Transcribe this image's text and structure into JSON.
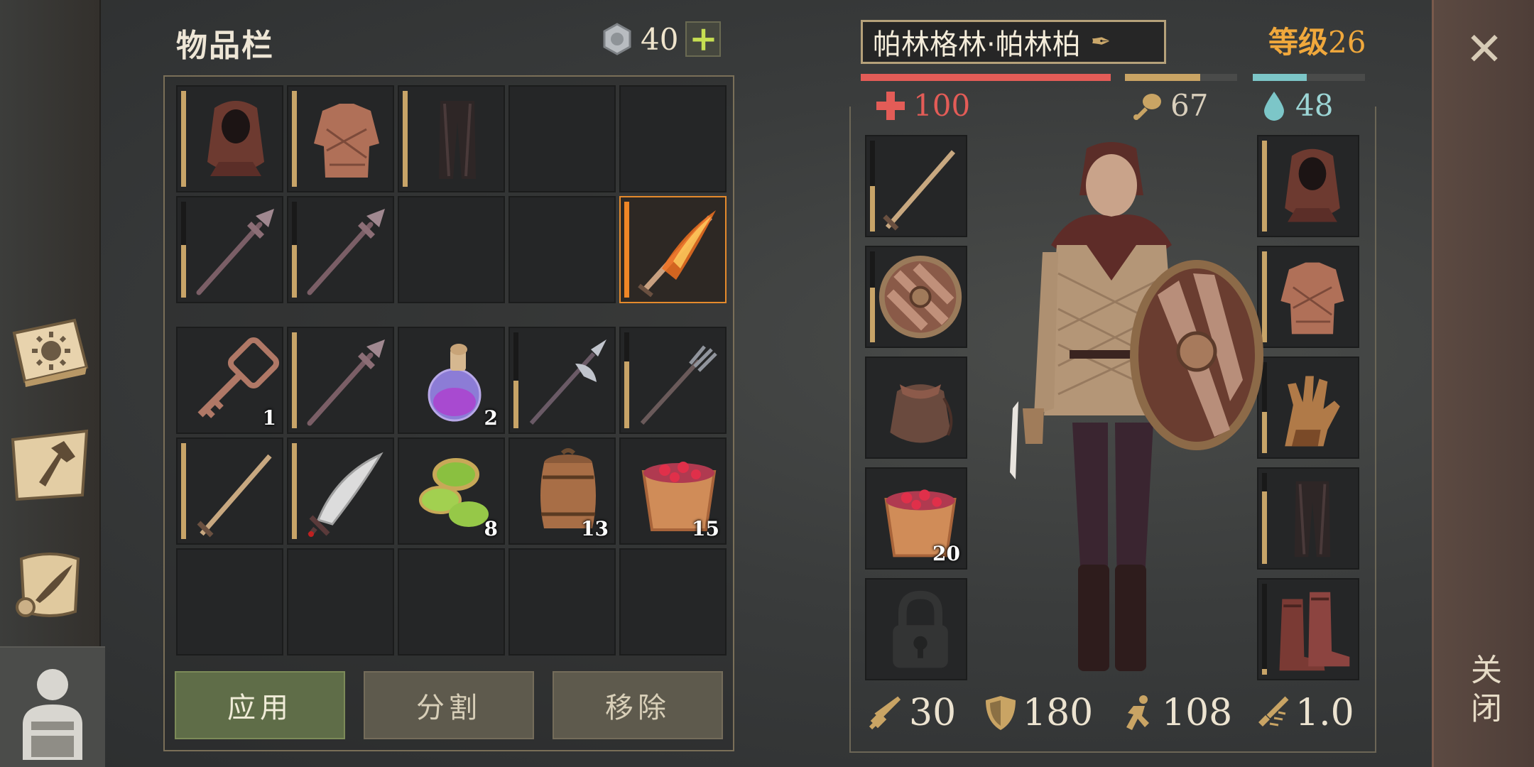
{
  "inventory": {
    "title": "物品栏",
    "coins": "40",
    "add_label": "+",
    "grid_top": [
      {
        "item": "hood",
        "durability": 1
      },
      {
        "item": "gambeson",
        "durability": 1
      },
      {
        "item": "trousers",
        "durability": 1
      },
      {
        "item": "empty"
      },
      {
        "item": "empty"
      },
      {
        "item": "spear",
        "durability": 0.55
      },
      {
        "item": "spear",
        "durability": 0.55
      },
      {
        "item": "empty"
      },
      {
        "item": "empty"
      },
      {
        "item": "flaming-sword",
        "durability": 1,
        "highlight": true
      }
    ],
    "grid_bottom": [
      {
        "item": "key",
        "qty": "1"
      },
      {
        "item": "spear",
        "durability": 1
      },
      {
        "item": "potion",
        "qty": "2"
      },
      {
        "item": "halberd",
        "durability": 0.5
      },
      {
        "item": "pitchfork",
        "durability": 0.7
      },
      {
        "item": "sword",
        "durability": 1
      },
      {
        "item": "scimitar",
        "durability": 1
      },
      {
        "item": "seeds",
        "qty": "8"
      },
      {
        "item": "barrel",
        "qty": "13"
      },
      {
        "item": "berry-bucket",
        "qty": "15"
      }
    ],
    "buttons": {
      "apply": "应用",
      "split": "分割",
      "remove": "移除"
    }
  },
  "character": {
    "name": "帕林格林·帕林柏",
    "level_label": "等级",
    "level": "26",
    "health": "100",
    "food": "67",
    "water": "48",
    "health_fraction": 1.0,
    "food_fraction": 0.67,
    "water_fraction": 0.48,
    "colors": {
      "health": "#e35c57",
      "food": "#c9a464",
      "water": "#7cc6c8"
    },
    "equip_left": [
      {
        "item": "sword",
        "durability": 0.5
      },
      {
        "item": "shield",
        "durability": 0.6
      },
      {
        "item": "pouch"
      },
      {
        "item": "berry-bucket",
        "qty": "20"
      },
      {
        "item": "locked"
      }
    ],
    "equip_right": [
      {
        "item": "hood",
        "durability": 1
      },
      {
        "item": "gambeson",
        "durability": 1
      },
      {
        "item": "gloves",
        "durability": 0.45
      },
      {
        "item": "trousers",
        "durability": 0.8
      },
      {
        "item": "boots",
        "durability": 0.06
      }
    ],
    "stats": {
      "attack": "30",
      "defense": "180",
      "speed": "108",
      "attack_speed": "1.0"
    }
  },
  "close_label": "关闭"
}
